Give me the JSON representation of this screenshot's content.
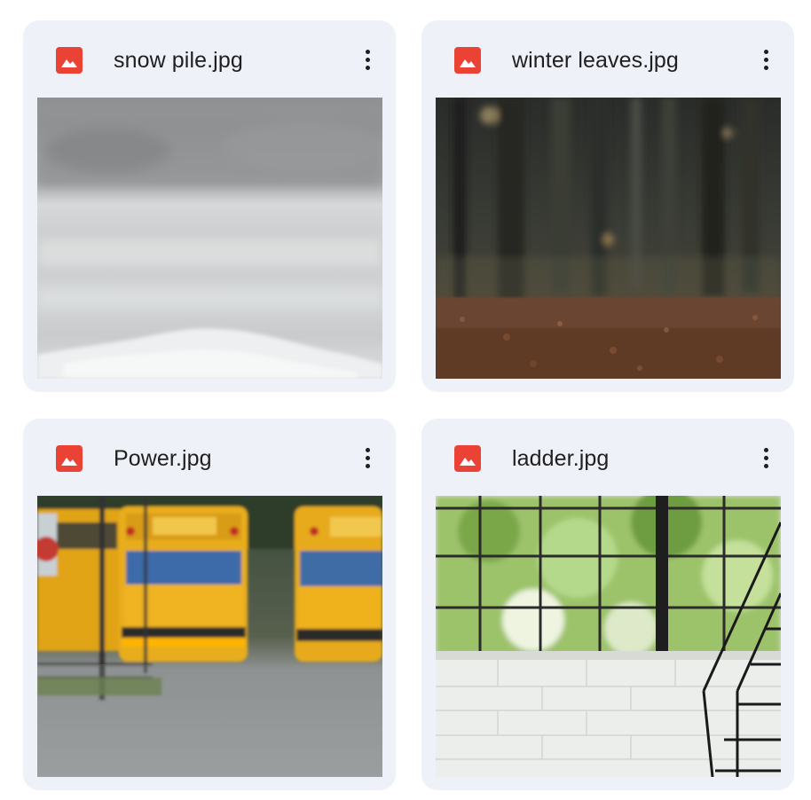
{
  "files": [
    {
      "name": "snow pile.jpg",
      "icon": "image-file-icon",
      "thumbnail": "snow pile scene"
    },
    {
      "name": "winter leaves.jpg",
      "icon": "image-file-icon",
      "thumbnail": "forest path with fallen leaves"
    },
    {
      "name": "Power.jpg",
      "icon": "image-file-icon",
      "thumbnail": "parked yellow school buses"
    },
    {
      "name": "ladder.jpg",
      "icon": "image-file-icon",
      "thumbnail": "greenhouse window with ladder"
    }
  ],
  "colors": {
    "card_background": "#eef1f7",
    "icon_red": "#ea4335",
    "text": "#1f1f1f"
  }
}
